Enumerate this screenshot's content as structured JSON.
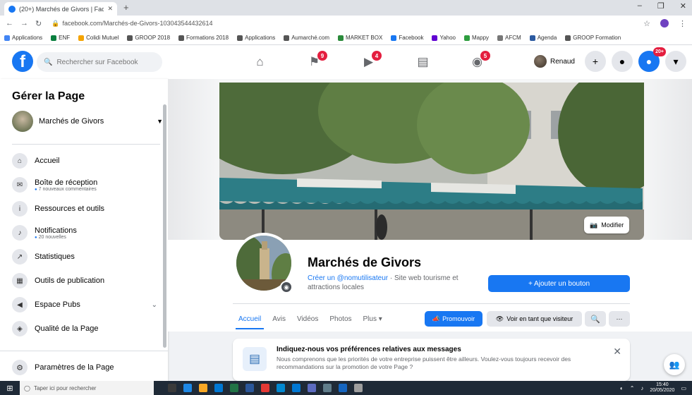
{
  "browser": {
    "tab_title": "(20+) Marchés de Givors | Facebook",
    "tab_close": "✕",
    "new_tab": "+",
    "url": "facebook.com/Marchés-de-Givors-103043544432614",
    "window_controls": [
      "–",
      "❐",
      "✕"
    ],
    "bookmarks": [
      "Applications",
      "ENF",
      "Colidi Mutuel",
      "GROOP 2018",
      "Formations 2018",
      "Applications",
      "Aumarché.com",
      "MARKET BOX",
      "Facebook",
      "Yahoo",
      "Mappy",
      "AFCM",
      "Agenda",
      "GROOP Formation"
    ]
  },
  "fbnav": {
    "logo": "f",
    "search_placeholder": "Rechercher sur Facebook",
    "center_badges": [
      "9",
      "4",
      "",
      "",
      "5"
    ],
    "user_name": "Renaud",
    "messenger_badge": "20+"
  },
  "sidebar": {
    "title": "Gérer la Page",
    "page_name": "Marchés de Givors",
    "items": [
      {
        "label": "Accueil",
        "sub": ""
      },
      {
        "label": "Boîte de réception",
        "sub": "7 nouveaux commentaires"
      },
      {
        "label": "Ressources et outils",
        "sub": ""
      },
      {
        "label": "Notifications",
        "sub": "20 nouvelles"
      },
      {
        "label": "Statistiques",
        "sub": ""
      },
      {
        "label": "Outils de publication",
        "sub": ""
      },
      {
        "label": "Espace Pubs",
        "sub": ""
      },
      {
        "label": "Qualité de la Page",
        "sub": ""
      }
    ],
    "settings_label": "Paramètres de la Page"
  },
  "cover": {
    "edit_label": "Modifier"
  },
  "page": {
    "name": "Marchés de Givors",
    "username_link": "Créer un @nomutilisateur",
    "category": " · Site web tourisme et attractions locales",
    "add_button": "+ Ajouter un bouton",
    "tabs": [
      "Accueil",
      "Avis",
      "Vidéos",
      "Photos",
      "Plus ▾"
    ],
    "promote_label": "Promouvoir",
    "visitor_label": "Voir en tant que visiteur",
    "more_label": "···"
  },
  "message_card": {
    "title": "Indiquez-nous vos préférences relatives aux messages",
    "body": "Nous comprenons que les priorités de votre entreprise puissent être ailleurs. Voulez-vous toujours recevoir des recommandations sur la promotion de votre Page ?"
  },
  "taskbar": {
    "search_placeholder": "Taper ici pour rechercher",
    "time": "15:40",
    "date": "20/05/2020"
  }
}
